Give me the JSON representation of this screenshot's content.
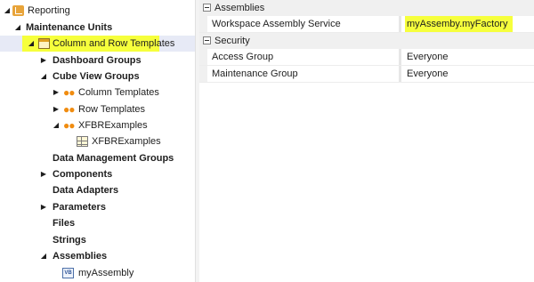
{
  "tree": {
    "root_label": "Reporting",
    "maintenance_units_label": "Maintenance Units",
    "column_row_templates_label": "Column and Row Templates",
    "dashboard_groups_label": "Dashboard Groups",
    "cube_view_groups_label": "Cube View Groups",
    "column_templates_label": "Column Templates",
    "row_templates_label": "Row Templates",
    "xfbr_examples_group_label": "XFBRExamples",
    "xfbr_examples_item_label": "XFBRExamples",
    "data_management_groups_label": "Data Management Groups",
    "components_label": "Components",
    "data_adapters_label": "Data Adapters",
    "parameters_label": "Parameters",
    "files_label": "Files",
    "strings_label": "Strings",
    "assemblies_label": "Assemblies",
    "my_assembly_label": "myAssembly",
    "vb_badge": "VB"
  },
  "properties": {
    "assemblies_category": "Assemblies",
    "workspace_assembly_service_name": "Workspace Assembly Service",
    "workspace_assembly_service_value": "myAssemby.myFactory",
    "security_category": "Security",
    "access_group_name": "Access Group",
    "access_group_value": "Everyone",
    "maintenance_group_name": "Maintenance Group",
    "maintenance_group_value": "Everyone"
  },
  "colors": {
    "highlight": "#f6ff3c",
    "selection": "#e7eaf6",
    "category_bg": "#f0f0f0"
  }
}
